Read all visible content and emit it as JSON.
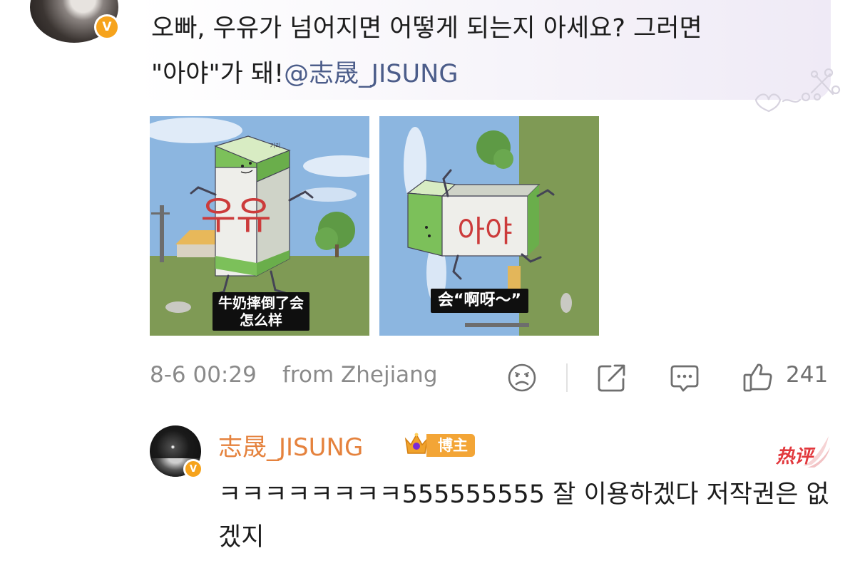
{
  "comment": {
    "text_line1": "오빠, 우유가 넘어지면 어떻게 되는지 아세요? 그러면",
    "text_line2_prefix": "\"아야\"가 돼!",
    "mention": "@志晟_JISUNG",
    "verified_badge": "V"
  },
  "images": [
    {
      "product_text": "우유",
      "caption_line1": "牛奶摔倒了会",
      "caption_line2": "怎么样",
      "carton_brand": "기리"
    },
    {
      "product_text": "아야",
      "caption_line1": "会“啊呀～”",
      "caption_line2": ""
    }
  ],
  "meta": {
    "time": "8-6 00:29",
    "location": "from Zhejiang",
    "like_count": "241",
    "icons": [
      "dislike-face-icon",
      "share-icon",
      "comment-icon",
      "like-thumb-icon"
    ]
  },
  "reply": {
    "username": "志晟_JISUNG",
    "host_badge": "博主",
    "hot_label": "热评",
    "text": "ㅋㅋㅋㅋㅋㅋㅋㅋ555555555 잘 이용하겠다 저작권은 없겠지",
    "verified_badge": "V"
  },
  "colors": {
    "username": "#e5823d",
    "mention": "#4c5d8a",
    "host_badge": "#f3a536",
    "hot": "#e2383d",
    "verified": "#f6a31c",
    "meta_text": "#8a8a8a"
  }
}
